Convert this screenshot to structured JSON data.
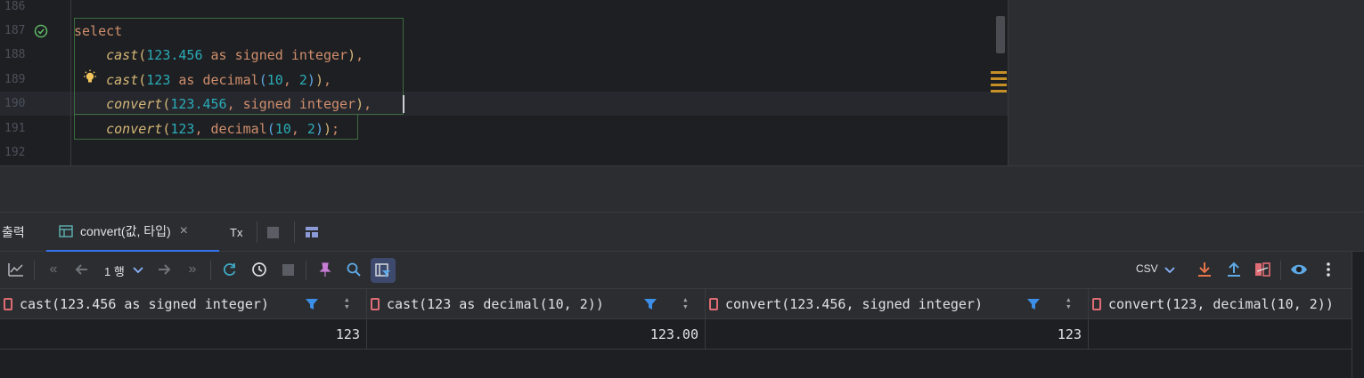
{
  "editor": {
    "line_numbers": [
      "186",
      "187",
      "188",
      "189",
      "190",
      "191",
      "192"
    ],
    "lines": [
      {
        "segments": [
          {
            "t": "select",
            "c": "kw"
          }
        ]
      },
      {
        "segments": [
          {
            "t": "    ",
            "c": ""
          },
          {
            "t": "cast",
            "c": "fn"
          },
          {
            "t": "(",
            "c": "par"
          },
          {
            "t": "123.456",
            "c": "num"
          },
          {
            "t": " as signed integer",
            "c": "kw"
          },
          {
            "t": ")",
            "c": "par"
          },
          {
            "t": ",",
            "c": "kw"
          }
        ]
      },
      {
        "segments": [
          {
            "t": "    ",
            "c": ""
          },
          {
            "t": "cast",
            "c": "fn"
          },
          {
            "t": "(",
            "c": "par"
          },
          {
            "t": "123",
            "c": "num"
          },
          {
            "t": " as decimal",
            "c": "kw"
          },
          {
            "t": "(",
            "c": "par2"
          },
          {
            "t": "10",
            "c": "num"
          },
          {
            "t": ", ",
            "c": "kw"
          },
          {
            "t": "2",
            "c": "num"
          },
          {
            "t": ")",
            "c": "par2"
          },
          {
            "t": ")",
            "c": "par"
          },
          {
            "t": ",",
            "c": "kw"
          }
        ]
      },
      {
        "segments": [
          {
            "t": "    ",
            "c": ""
          },
          {
            "t": "convert",
            "c": "fn"
          },
          {
            "t": "(",
            "c": "par"
          },
          {
            "t": "123.456",
            "c": "num"
          },
          {
            "t": ", signed integer",
            "c": "kw"
          },
          {
            "t": ")",
            "c": "par"
          },
          {
            "t": ",",
            "c": "kw"
          }
        ]
      },
      {
        "segments": [
          {
            "t": "    ",
            "c": ""
          },
          {
            "t": "convert",
            "c": "fn"
          },
          {
            "t": "(",
            "c": "par"
          },
          {
            "t": "123",
            "c": "num"
          },
          {
            "t": ", decimal",
            "c": "kw"
          },
          {
            "t": "(",
            "c": "par2"
          },
          {
            "t": "10",
            "c": "num"
          },
          {
            "t": ", ",
            "c": "kw"
          },
          {
            "t": "2",
            "c": "num"
          },
          {
            "t": ")",
            "c": "par2"
          },
          {
            "t": ")",
            "c": "par"
          },
          {
            "t": ";",
            "c": "kw"
          }
        ]
      }
    ]
  },
  "tabs": {
    "output_label": "출력",
    "result_label": "convert(값, 타입)",
    "close_glyph": "×",
    "tx_label": "Tx"
  },
  "toolbar": {
    "row_count": "1 행",
    "export_format": "CSV"
  },
  "grid": {
    "columns": [
      "cast(123.456 as signed integer)",
      "cast(123 as decimal(10, 2))",
      "convert(123.456, signed integer)",
      "convert(123, decimal(10, 2))"
    ],
    "rows": [
      [
        "123",
        "123.00",
        "123",
        ""
      ]
    ]
  },
  "colors": {
    "accent": "#3574f0",
    "keyword": "#cf8e6d",
    "number": "#2aacb8",
    "function": "#d5b778",
    "ok_check": "#5fb865",
    "warning": "#c69026"
  }
}
